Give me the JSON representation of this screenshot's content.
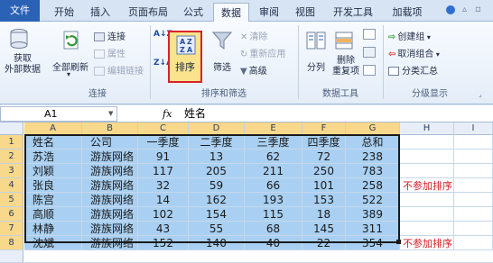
{
  "tabs": [
    "文件",
    "开始",
    "插入",
    "页面布局",
    "公式",
    "数据",
    "审阅",
    "视图",
    "开发工具",
    "加载项"
  ],
  "ribbon": {
    "get_external": "获取\n外部数据",
    "refresh_all": "全部刷新",
    "connections": "连接",
    "properties": "属性",
    "edit_links": "编辑链接",
    "group_connections": "连接",
    "sort_az": "A↓Z",
    "sort_za": "Z↓A",
    "sort": "排序",
    "filter": "筛选",
    "clear": "清除",
    "reapply": "重新应用",
    "advanced": "高级",
    "group_sort_filter": "排序和筛选",
    "text_to_columns": "分列",
    "remove_duplicates": "删除\n重复项",
    "group_data_tools": "数据工具",
    "group": "创建组",
    "ungroup": "取消组合",
    "subtotal": "分类汇总",
    "group_outline": "分级显示"
  },
  "formula_bar": {
    "cell_ref": "A1",
    "fx": "fx",
    "value": "姓名"
  },
  "columns": [
    "A",
    "B",
    "C",
    "D",
    "E",
    "F",
    "G",
    "H",
    "I"
  ],
  "rows": [
    "1",
    "2",
    "3",
    "4",
    "5",
    "6",
    "7",
    "8"
  ],
  "table": {
    "header": [
      "姓名",
      "公司",
      "一季度",
      "二季度",
      "三季度",
      "四季度",
      "总和"
    ],
    "data": [
      [
        "苏浩",
        "游族网络",
        "91",
        "13",
        "62",
        "72",
        "238"
      ],
      [
        "刘颖",
        "游族网络",
        "117",
        "205",
        "211",
        "250",
        "783"
      ],
      [
        "张良",
        "游族网络",
        "32",
        "59",
        "66",
        "101",
        "258"
      ],
      [
        "陈宫",
        "游族网络",
        "14",
        "162",
        "193",
        "153",
        "522"
      ],
      [
        "高顺",
        "游族网络",
        "102",
        "154",
        "115",
        "18",
        "389"
      ],
      [
        "林静",
        "游族网络",
        "43",
        "55",
        "68",
        "145",
        "311"
      ],
      [
        "沈斌",
        "游族网络",
        "152",
        "140",
        "40",
        "22",
        "354"
      ]
    ]
  },
  "notes": {
    "row4": "不参加排序",
    "row8": "不参加排序"
  }
}
